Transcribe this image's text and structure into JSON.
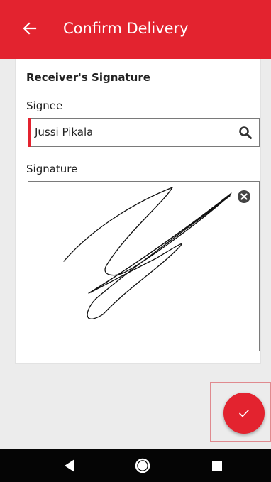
{
  "app_bar": {
    "title": "Confirm Delivery",
    "back_icon": "arrow-left-icon",
    "color": "#e3232f"
  },
  "form": {
    "section_title": "Receiver's Signature",
    "signee_label": "Signee",
    "signee_value": "Jussi Pikala",
    "search_icon": "search-icon",
    "signature_label": "Signature",
    "clear_icon": "close-circle-icon"
  },
  "fab": {
    "icon": "check-icon",
    "color": "#e3232f"
  },
  "nav_bar": {
    "back_icon": "triangle-back-icon",
    "home_icon": "circle-home-icon",
    "recents_icon": "square-recents-icon"
  }
}
